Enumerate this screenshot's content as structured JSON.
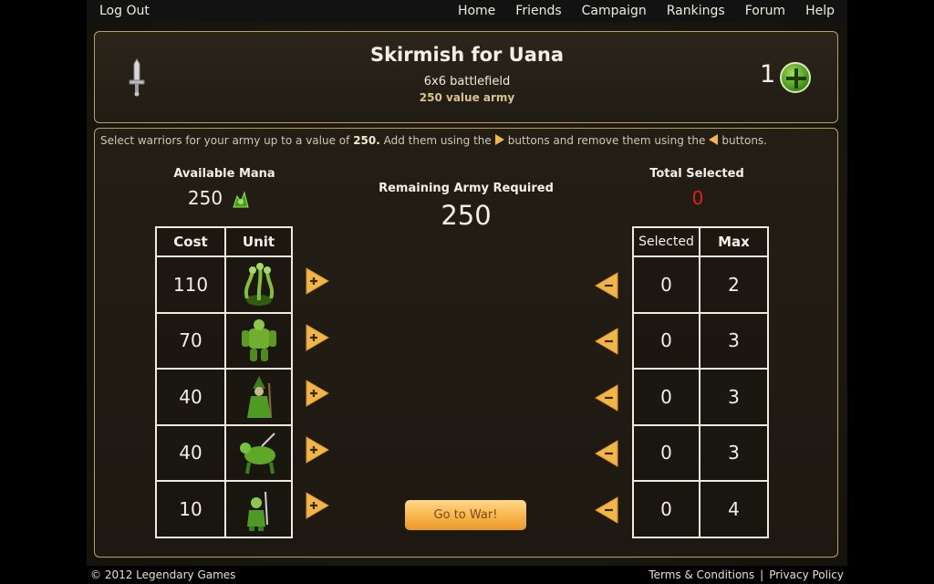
{
  "nav": {
    "logout": "Log Out",
    "links": [
      "Home",
      "Friends",
      "Campaign",
      "Rankings",
      "Forum",
      "Help"
    ]
  },
  "header": {
    "title": "Skirmish for Uana",
    "battlefield": "6x6 battlefield",
    "army_value": "250 value army",
    "count": "1"
  },
  "instructions": {
    "part1": "Select warriors for your army up to a value of",
    "value": "250.",
    "part2": "Add them using the",
    "part3": "buttons and remove them using the",
    "part4": "buttons."
  },
  "mana": {
    "label": "Available Mana",
    "value": "250"
  },
  "remaining": {
    "label": "Remaining Army Required",
    "value": "250"
  },
  "total": {
    "label": "Total Selected",
    "value": "0"
  },
  "left_table": {
    "headers": [
      "Cost",
      "Unit"
    ],
    "rows": [
      {
        "cost": "110",
        "unit_icon": "hydra-unit-icon"
      },
      {
        "cost": "70",
        "unit_icon": "golem-unit-icon"
      },
      {
        "cost": "40",
        "unit_icon": "wizard-unit-icon"
      },
      {
        "cost": "40",
        "unit_icon": "beast-unit-icon"
      },
      {
        "cost": "10",
        "unit_icon": "goblin-unit-icon"
      }
    ]
  },
  "right_table": {
    "headers": [
      "Selected",
      "Max"
    ],
    "rows": [
      {
        "selected": "0",
        "max": "2"
      },
      {
        "selected": "0",
        "max": "3"
      },
      {
        "selected": "0",
        "max": "3"
      },
      {
        "selected": "0",
        "max": "3"
      },
      {
        "selected": "0",
        "max": "4"
      }
    ]
  },
  "go_button": "Go to War!",
  "footer": {
    "copyright": "© 2012 Legendary Games",
    "terms": "Terms & Conditions",
    "separator": "|",
    "privacy": "Privacy Policy"
  },
  "colors": {
    "accent": "#f1b548",
    "total_selected": "#e02020",
    "border": "#b89e6a"
  }
}
